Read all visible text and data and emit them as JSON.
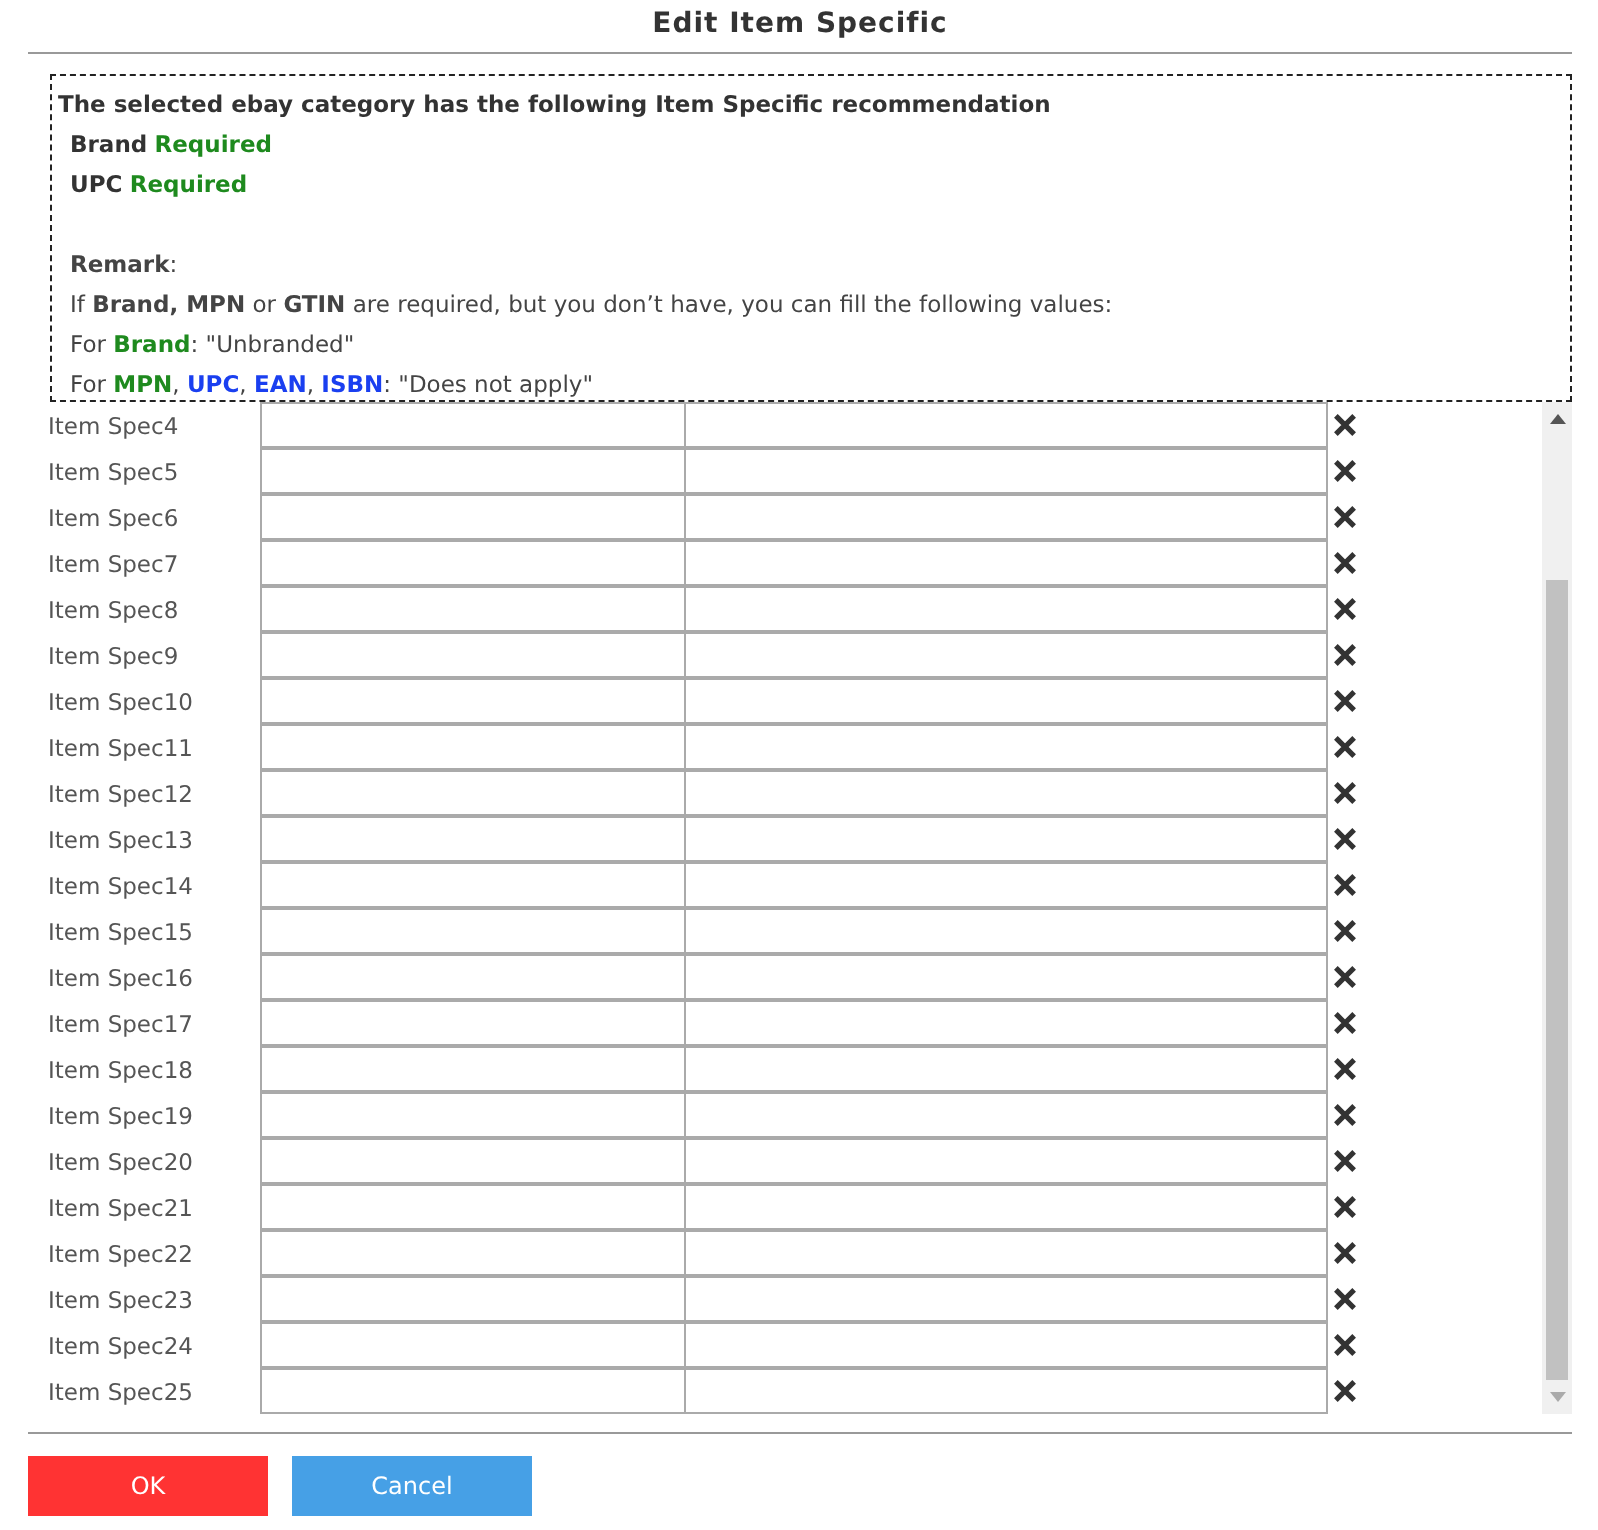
{
  "dialog": {
    "title": "Edit Item Specific"
  },
  "notice": {
    "heading": "The selected ebay category has the following Item Specific recommendation",
    "requirements": [
      {
        "name": "Brand",
        "status": "Required"
      },
      {
        "name": "UPC",
        "status": "Required"
      }
    ],
    "remark": "**Remark**:",
    "lines": [
      [
        {
          "text": "If "
        },
        {
          "text": "Brand, MPN",
          "bold": true
        },
        {
          "text": " or "
        },
        {
          "text": "GTIN",
          "bold": true
        },
        {
          "text": " are required, but you don’t have, you can fill the following values:"
        }
      ],
      [
        {
          "text": "For "
        },
        {
          "text": "Brand",
          "bold": true,
          "color": "#1e8a1e"
        },
        {
          "text": ": \"Unbranded\""
        }
      ],
      [
        {
          "text": "For "
        },
        {
          "text": "MPN",
          "bold": true,
          "color": "#1e8a1e"
        },
        {
          "text": ", "
        },
        {
          "text": "UPC",
          "bold": true,
          "color": "#1a3ff0"
        },
        {
          "text": ", "
        },
        {
          "text": "EAN",
          "bold": true,
          "color": "#1a3ff0"
        },
        {
          "text": ", "
        },
        {
          "text": "ISBN",
          "bold": true,
          "color": "#1a3ff0"
        },
        {
          "text": ": \"Does not apply\""
        }
      ]
    ]
  },
  "rows": [
    {
      "label": "Item Spec4"
    },
    {
      "label": "Item Spec5"
    },
    {
      "label": "Item Spec6"
    },
    {
      "label": "Item Spec7"
    },
    {
      "label": "Item Spec8"
    },
    {
      "label": "Item Spec9"
    },
    {
      "label": "Item Spec10"
    },
    {
      "label": "Item Spec11"
    },
    {
      "label": "Item Spec12"
    },
    {
      "label": "Item Spec13"
    },
    {
      "label": "Item Spec14"
    },
    {
      "label": "Item Spec15"
    },
    {
      "label": "Item Spec16"
    },
    {
      "label": "Item Spec17"
    },
    {
      "label": "Item Spec18"
    },
    {
      "label": "Item Spec19"
    },
    {
      "label": "Item Spec20"
    },
    {
      "label": "Item Spec21"
    },
    {
      "label": "Item Spec22"
    },
    {
      "label": "Item Spec23"
    },
    {
      "label": "Item Spec24"
    },
    {
      "label": "Item Spec25"
    }
  ],
  "buttons": [
    {
      "label": "OK",
      "kind": "primary"
    },
    {
      "label": "Cancel",
      "kind": "secondary"
    }
  ]
}
